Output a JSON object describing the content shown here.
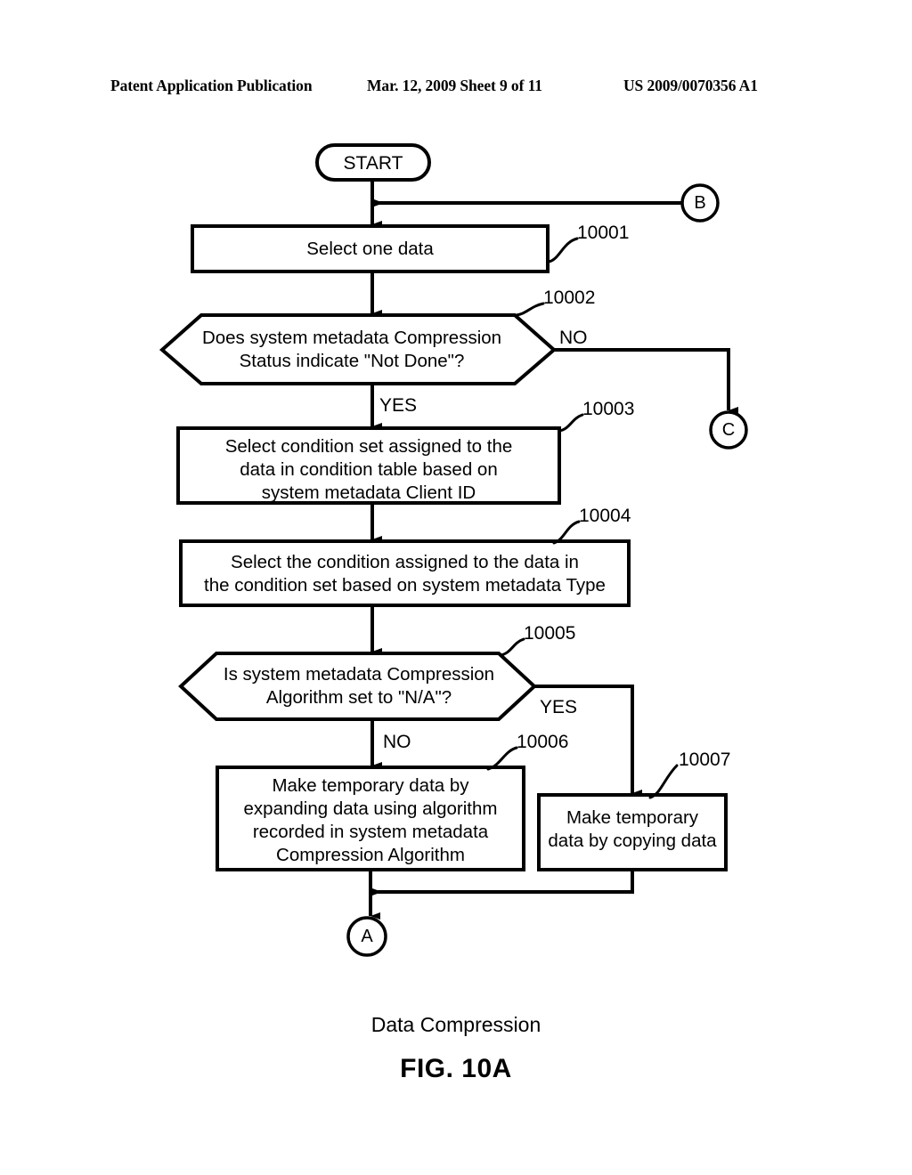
{
  "header": {
    "left": "Patent Application Publication",
    "middle": "Mar. 12, 2009  Sheet 9 of 11",
    "right": "US 2009/0070356 A1"
  },
  "flowchart": {
    "title": "Data Compression",
    "figure_number": "FIG. 10A",
    "nodes": {
      "start": {
        "label": "START",
        "shape": "terminator"
      },
      "n10001": {
        "ref": "10001",
        "text": "Select one data",
        "shape": "process"
      },
      "n10002": {
        "ref": "10002",
        "text": "Does system metadata Compression\nStatus indicate \"Not Done\"?",
        "shape": "decision"
      },
      "n10003": {
        "ref": "10003",
        "text": "Select condition set assigned to the\ndata in condition table based on\nsystem metadata Client ID",
        "shape": "process"
      },
      "n10004": {
        "ref": "10004",
        "text": "Select the condition assigned to the data in\nthe condition set based on system metadata Type",
        "shape": "process"
      },
      "n10005": {
        "ref": "10005",
        "text": "Is system metadata Compression\nAlgorithm set to \"N/A\"?",
        "shape": "decision"
      },
      "n10006": {
        "ref": "10006",
        "text": "Make temporary data by\nexpanding data using algorithm\nrecorded in system metadata\nCompression Algorithm",
        "shape": "process"
      },
      "n10007": {
        "ref": "10007",
        "text": "Make temporary\ndata by copying data",
        "shape": "process"
      }
    },
    "connectors": {
      "b": "B",
      "c": "C",
      "a": "A"
    },
    "branch_labels": {
      "d10002_no": "NO",
      "d10002_yes": "YES",
      "d10005_yes": "YES",
      "d10005_no": "NO"
    }
  },
  "colors": {
    "ink": "#000000",
    "paper": "#ffffff"
  }
}
